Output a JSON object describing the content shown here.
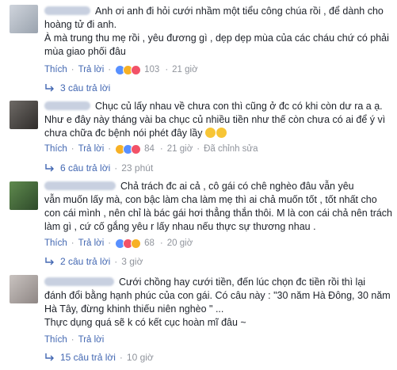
{
  "colors": {
    "link": "#4267b2",
    "meta": "#90949c",
    "text": "#1d2129"
  },
  "comments": [
    {
      "lines": [
        "Anh ơi anh đi hỏi cưới nhầm một tiểu công chúa rồi , để dành cho",
        "hoàng tử đi anh.",
        "À mà trung thu mẹ rồi , yêu đương gì , dẹp dẹp mùa của các cháu chứ có phải",
        "mùa giao phối đâu"
      ],
      "actions": {
        "like": "Thích",
        "reply": "Trả lời",
        "reaction_count": "103",
        "time": "21 giờ"
      },
      "replies": "3 câu trả lời"
    },
    {
      "lines": [
        "Chục củ lấy nhau về chưa con thì cũng ở đc có khi còn dư ra a ạ.",
        "Như e đây này tháng vài ba chục củ nhiều tiền như thế còn chưa có ai để ý vì",
        "chưa chữa đc bệnh nói phét đây lầy"
      ],
      "actions": {
        "like": "Thích",
        "reply": "Trả lời",
        "reaction_count": "84",
        "time": "21 giờ",
        "edited": "Đã chỉnh sửa"
      },
      "replies": "6 câu trả lời",
      "reply_time": "23 phút"
    },
    {
      "lines": [
        "Chả trách đc ai cả , cô gái có chê nghèo đâu vẫn yêu",
        "vẫn muốn lấy mà, con bậc làm cha làm mẹ thì ai chả muốn tốt , tốt nhất cho",
        "con cái mình , nên chỉ là bác gái hơi thẳng thắn thôi. M là con cái chả nên trách",
        "làm gì , cứ cố gắng yêu r lấy nhau nếu thực sự thương nhau ."
      ],
      "actions": {
        "like": "Thích",
        "reply": "Trả lời",
        "reaction_count": "68",
        "time": "20 giờ"
      },
      "replies": "2 câu trả lời",
      "reply_time": "3 giờ"
    },
    {
      "lines": [
        "Cưới chồng hay cưới tiền, đến lúc chọn đc tiền rồi thì lại",
        "đánh đổi bằng hạnh phúc của con gái. Có câu này : \"30 năm Hà Đông, 30 năm",
        "Hà Tây, đừng khinh thiếu niên nghèo \" ...",
        "Thực dụng quá sẽ k có kết cục hoàn mĩ đâu ~"
      ],
      "actions": {
        "like": "Thích",
        "reply": "Trả lời"
      },
      "replies": "15 câu trả lời",
      "reply_time": "10 giờ"
    }
  ]
}
